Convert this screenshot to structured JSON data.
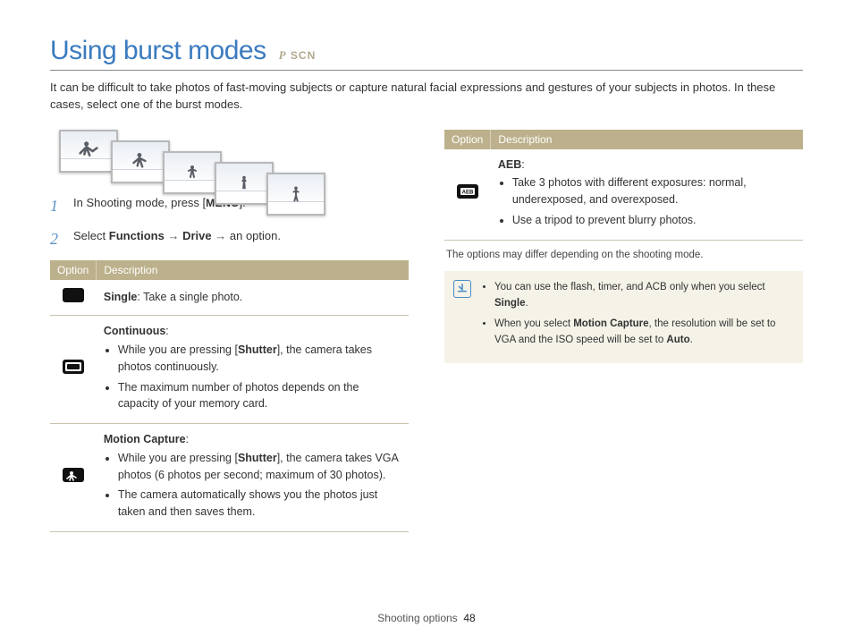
{
  "header": {
    "title": "Using burst modes",
    "modes": [
      "P",
      "SCN"
    ]
  },
  "intro": "It can be difficult to take photos of fast-moving subjects or capture natural facial expressions and gestures of your subjects in photos. In these cases, select one of the burst modes.",
  "steps": {
    "s1": {
      "num": "1",
      "pre": "In Shooting mode, press [",
      "menu": "MENU",
      "post": "]."
    },
    "s2": {
      "num": "2",
      "pre": "Select ",
      "b1": "Functions",
      "arrow": "→",
      "b2": "Drive",
      "post": " an option."
    }
  },
  "table1": {
    "head_option": "Option",
    "head_desc": "Description",
    "rows": [
      {
        "icon": "single-icon",
        "title": "Single",
        "title_suffix": ": Take a single photo.",
        "bullets": []
      },
      {
        "icon": "continuous-icon",
        "title": "Continuous",
        "title_suffix": ":",
        "bullets": [
          {
            "pre": "While you are pressing [",
            "b": "Shutter",
            "post": "], the camera takes photos continuously."
          },
          {
            "pre": "The maximum number of photos depends on the capacity of your memory card.",
            "b": "",
            "post": ""
          }
        ]
      },
      {
        "icon": "motion-capture-icon",
        "title": "Motion Capture",
        "title_suffix": ":",
        "bullets": [
          {
            "pre": "While you are pressing [",
            "b": "Shutter",
            "post": "], the camera takes VGA photos (6 photos per second; maximum of 30 photos)."
          },
          {
            "pre": "The camera automatically shows you the photos just taken and then saves them.",
            "b": "",
            "post": ""
          }
        ]
      }
    ]
  },
  "table2": {
    "head_option": "Option",
    "head_desc": "Description",
    "rows": [
      {
        "icon": "aeb-icon",
        "title": "AEB",
        "title_suffix": ":",
        "bullets": [
          {
            "pre": "Take 3 photos with different exposures: normal, underexposed, and overexposed.",
            "b": "",
            "post": ""
          },
          {
            "pre": "Use a tripod to prevent blurry photos.",
            "b": "",
            "post": ""
          }
        ]
      }
    ]
  },
  "note": "The options may differ depending on the shooting mode.",
  "infobox": {
    "items": [
      {
        "pre": "You can use the flash, timer, and ACB only when you select ",
        "b": "Single",
        "post": "."
      },
      {
        "pre": "When you select ",
        "b": "Motion Capture",
        "post_pre": ", the resolution will be set to VGA and the ISO speed will be set to ",
        "b2": "Auto",
        "post": "."
      }
    ]
  },
  "footer": {
    "section": "Shooting options",
    "page": "48"
  }
}
